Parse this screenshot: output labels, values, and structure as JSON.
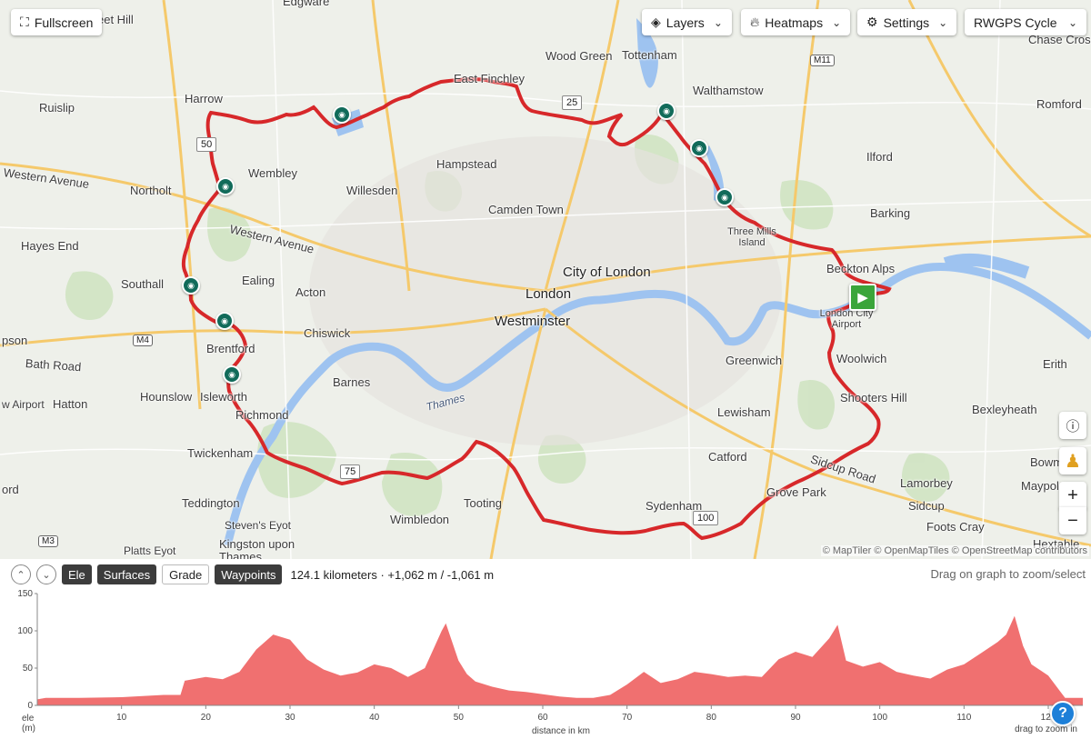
{
  "map": {
    "controls": {
      "fullscreen_label": "Fullscreen",
      "layers_label": "Layers",
      "heatmaps_label": "Heatmaps",
      "settings_label": "Settings",
      "basemap_label": "RWGPS Cycle"
    },
    "places": [
      {
        "name": "Edgware",
        "cls": "mid"
      },
      {
        "name": "Wood Green",
        "cls": "mid"
      },
      {
        "name": "Tottenham",
        "cls": "mid"
      },
      {
        "name": "Harrow",
        "cls": "mid"
      },
      {
        "name": "East Finchley",
        "cls": "mid"
      },
      {
        "name": "Walthamstow",
        "cls": "mid"
      },
      {
        "name": "Romford",
        "cls": "mid"
      },
      {
        "name": "Ruislip",
        "cls": "mid"
      },
      {
        "name": "Chase Cross",
        "cls": "mid"
      },
      {
        "name": "Hampstead",
        "cls": "mid"
      },
      {
        "name": "Ilford",
        "cls": "mid"
      },
      {
        "name": "Western Avenue",
        "cls": "mid"
      },
      {
        "name": "Wembley",
        "cls": "mid"
      },
      {
        "name": "Northolt",
        "cls": "mid"
      },
      {
        "name": "Willesden",
        "cls": "mid"
      },
      {
        "name": "Camden Town",
        "cls": "mid"
      },
      {
        "name": "Barking",
        "cls": "mid"
      },
      {
        "name": "Western Avenue",
        "cls": "mid"
      },
      {
        "name": "Three Mills Island",
        "cls": ""
      },
      {
        "name": "Hayes End",
        "cls": "mid"
      },
      {
        "name": "Beckton Alps",
        "cls": "mid"
      },
      {
        "name": "City of London",
        "cls": "big"
      },
      {
        "name": "Southall",
        "cls": "mid"
      },
      {
        "name": "Ealing",
        "cls": "mid"
      },
      {
        "name": "Acton",
        "cls": "mid"
      },
      {
        "name": "London",
        "cls": "big"
      },
      {
        "name": "Westminster",
        "cls": "big"
      },
      {
        "name": "London City Airport",
        "cls": ""
      },
      {
        "name": "Chiswick",
        "cls": "mid"
      },
      {
        "name": "Brentford",
        "cls": "mid"
      },
      {
        "name": "Woolwich",
        "cls": "mid"
      },
      {
        "name": "Greenwich",
        "cls": "mid"
      },
      {
        "name": "Bath Road",
        "cls": "mid"
      },
      {
        "name": "Erith",
        "cls": "mid"
      },
      {
        "name": "Barnes",
        "cls": "mid"
      },
      {
        "name": "Hounslow",
        "cls": "mid"
      },
      {
        "name": "Isleworth",
        "cls": "mid"
      },
      {
        "name": "Shooters Hill",
        "cls": "mid"
      },
      {
        "name": "Hatton",
        "cls": "mid"
      },
      {
        "name": "Thames",
        "cls": "italic"
      },
      {
        "name": "Lewisham",
        "cls": "mid"
      },
      {
        "name": "Bexleyheath",
        "cls": "mid"
      },
      {
        "name": "Richmond",
        "cls": "mid"
      },
      {
        "name": "Twickenham",
        "cls": "mid"
      },
      {
        "name": "Catford",
        "cls": "mid"
      },
      {
        "name": "Sidcup Road",
        "cls": "mid"
      },
      {
        "name": "Bowm",
        "cls": "mid"
      },
      {
        "name": "Lamorbey",
        "cls": "mid"
      },
      {
        "name": "Maypole",
        "cls": "mid"
      },
      {
        "name": "Grove Park",
        "cls": "mid"
      },
      {
        "name": "Tooting",
        "cls": "mid"
      },
      {
        "name": "Sydenham",
        "cls": "mid"
      },
      {
        "name": "Sidcup",
        "cls": "mid"
      },
      {
        "name": "Teddington",
        "cls": "mid"
      },
      {
        "name": "Wimbledon",
        "cls": "mid"
      },
      {
        "name": "Foots Cray",
        "cls": "mid"
      },
      {
        "name": "Steven's Eyot",
        "cls": ""
      },
      {
        "name": "Kingston upon Thames",
        "cls": "mid"
      },
      {
        "name": "Hextable",
        "cls": "mid"
      },
      {
        "name": "Platts Eyot",
        "cls": ""
      },
      {
        "name": "eet Hill",
        "cls": "mid"
      },
      {
        "name": "pson",
        "cls": "mid"
      },
      {
        "name": "ord",
        "cls": "mid"
      },
      {
        "name": "w Airport",
        "cls": "mid"
      }
    ],
    "motorways": [
      "M11",
      "M4",
      "M3"
    ],
    "km_markers": [
      "25",
      "50",
      "75",
      "100"
    ],
    "attribution": "© MapTiler © OpenMapTiles © OpenStreetMap contributors",
    "route_color": "#d7282a"
  },
  "elevation": {
    "tabs": [
      "Ele",
      "Surfaces",
      "Grade",
      "Waypoints"
    ],
    "active_tab": "Ele",
    "stats": "124.1 kilometers · +1,062 m / -1,061 m",
    "hint": "Drag on graph to zoom/select",
    "y_label": "ele\n(m)",
    "y_label_1": "ele",
    "y_label_2": "(m)",
    "x_label": "distance in km",
    "zoom_hint": "drag to zoom in",
    "help_label": "?",
    "fill_color": "#f07070"
  },
  "chart_data": {
    "type": "area",
    "title": "",
    "xlabel": "distance in km",
    "ylabel": "ele (m)",
    "xlim": [
      0,
      124.1
    ],
    "ylim": [
      0,
      150
    ],
    "x_ticks": [
      10,
      20,
      30,
      40,
      50,
      60,
      70,
      80,
      90,
      100,
      110,
      120
    ],
    "y_ticks": [
      0,
      50,
      100,
      150
    ],
    "series": [
      {
        "x": [
          0,
          1,
          5,
          10,
          15,
          17,
          17.5,
          20,
          22,
          24,
          26,
          28,
          30,
          32,
          34,
          36,
          38,
          40,
          42,
          44,
          46,
          48,
          48.5,
          50,
          51,
          52,
          54,
          56,
          58,
          60,
          62,
          64,
          66,
          68,
          70,
          72,
          74,
          76,
          78,
          80,
          82,
          84,
          86,
          88,
          90,
          92,
          94,
          95,
          96,
          98,
          100,
          102,
          104,
          106,
          108,
          110,
          112,
          114,
          115,
          116,
          117,
          118,
          120,
          122,
          124.1
        ],
        "y": [
          8,
          10,
          10,
          11,
          14,
          14,
          33,
          38,
          35,
          45,
          75,
          95,
          88,
          62,
          48,
          40,
          44,
          55,
          50,
          38,
          50,
          100,
          110,
          60,
          42,
          32,
          25,
          20,
          18,
          15,
          12,
          10,
          10,
          14,
          28,
          45,
          30,
          35,
          45,
          42,
          38,
          40,
          38,
          62,
          72,
          65,
          90,
          108,
          60,
          52,
          58,
          45,
          40,
          36,
          48,
          55,
          70,
          85,
          95,
          120,
          80,
          55,
          40,
          10,
          10
        ]
      }
    ]
  }
}
